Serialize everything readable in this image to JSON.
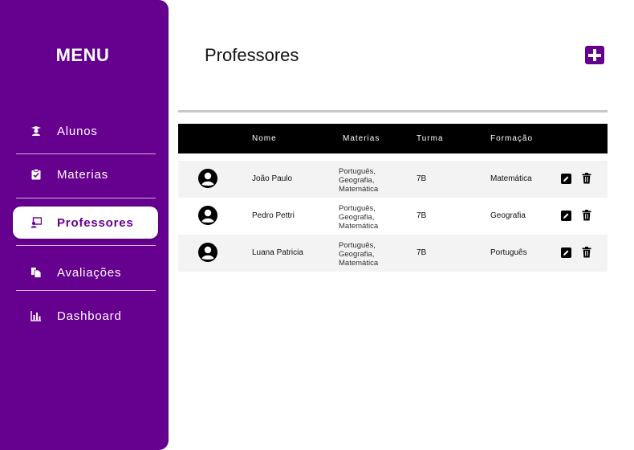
{
  "sidebar": {
    "title": "MENU",
    "items": [
      {
        "label": "Alunos",
        "icon": "student-icon"
      },
      {
        "label": "Materias",
        "icon": "clipboard-check-icon"
      },
      {
        "label": "Professores",
        "icon": "teacher-icon",
        "active": true
      },
      {
        "label": "Avaliações",
        "icon": "files-icon"
      },
      {
        "label": "Dashboard",
        "icon": "bar-chart-icon"
      }
    ]
  },
  "header": {
    "title": "Professores",
    "add_icon": "plus-icon"
  },
  "table": {
    "columns": [
      "Nome",
      "Materias",
      "Turma",
      "Formação"
    ],
    "rows": [
      {
        "nome": "João Paulo",
        "materias": [
          "Português,",
          "Geografia,",
          "Matemática"
        ],
        "turma": "7B",
        "formacao": "Matemática"
      },
      {
        "nome": "Pedro Pettri",
        "materias": [
          "Português,",
          "Geografia,",
          "Matemática"
        ],
        "turma": "7B",
        "formacao": "Geografia"
      },
      {
        "nome": "Luana Patricia",
        "materias": [
          "Português,",
          "Geografia,",
          "Matemática"
        ],
        "turma": "7B",
        "formacao": "Português"
      }
    ]
  },
  "colors": {
    "brand": "#66008f",
    "header_bg": "#000000",
    "row_alt": "#f3f3f3"
  }
}
